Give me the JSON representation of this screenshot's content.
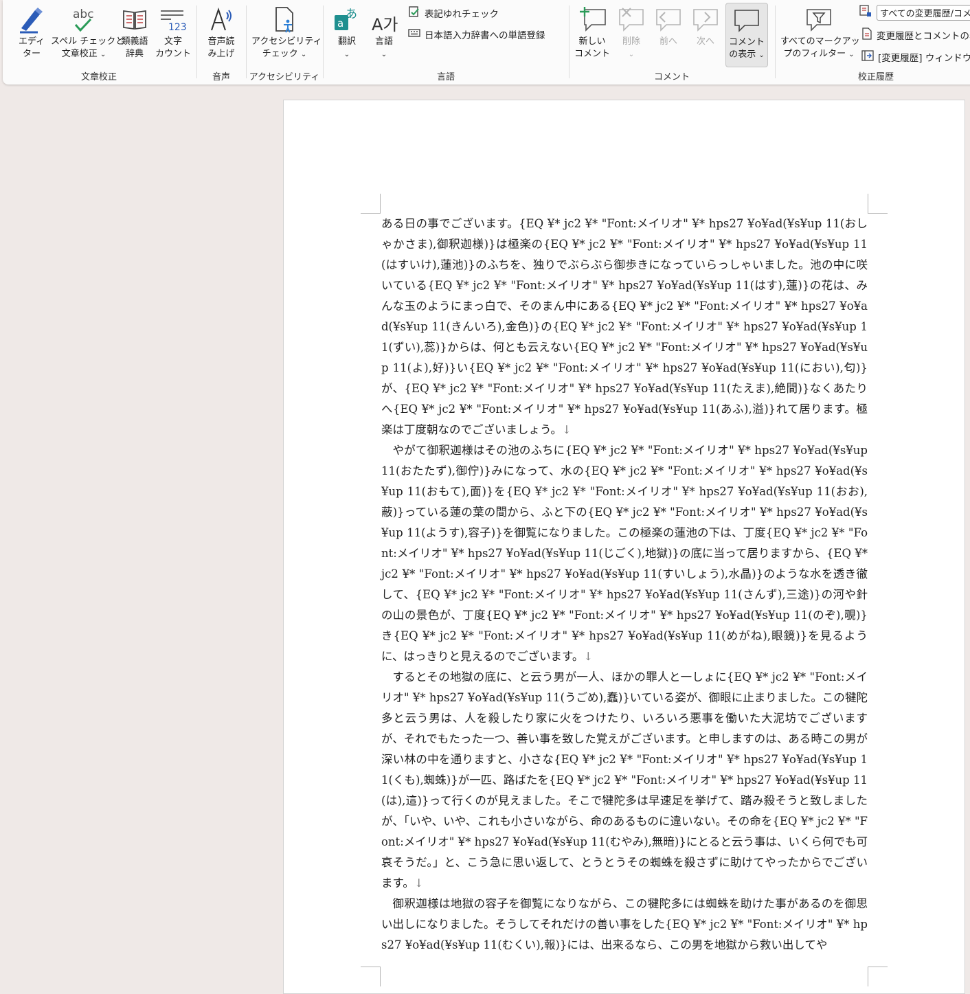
{
  "ribbon": {
    "groups": {
      "proofing": {
        "label": "文章校正",
        "editor": {
          "line1": "エディ",
          "line2": "ター"
        },
        "spelling": {
          "icon_text": "abc",
          "line1": "スペル チェックと",
          "line2": "文章校正"
        },
        "thesaurus": {
          "line1": "類義語",
          "line2": "辞典"
        },
        "wordcount": {
          "icon_text": "123",
          "line1": "文字",
          "line2": "カウント"
        }
      },
      "speech": {
        "label": "音声",
        "readaloud": {
          "line1": "音声読",
          "line2": "み上げ"
        }
      },
      "accessibility": {
        "label": "アクセシビリティ",
        "check": {
          "line1": "アクセシビリティ",
          "line2": "チェック"
        }
      },
      "language": {
        "label": "言語",
        "translate": {
          "label": "翻訳"
        },
        "language": {
          "icon_text": "A가",
          "label": "言語"
        },
        "consistency": "表記ゆれチェック",
        "dictionary": "日本語入力辞書への単語登録"
      },
      "comments": {
        "label": "コメント",
        "new": {
          "line1": "新しい",
          "line2": "コメント"
        },
        "delete": {
          "label": "削除"
        },
        "prev": {
          "label": "前へ"
        },
        "next": {
          "label": "次へ"
        },
        "show": {
          "line1": "コメント",
          "line2": "の表示"
        }
      },
      "tracking": {
        "label": "校正履歴",
        "filter": {
          "line1": "すべてのマークアッ",
          "line2": "プのフィルター"
        },
        "markup_combo": "すべての変更履歴/コメ",
        "show_markup": "変更履歴とコメントの表",
        "pane": "[変更履歴] ウィンドウ"
      }
    }
  },
  "document": {
    "paragraphs": [
      "ある日の事でございます。{EQ ¥* jc2 ¥* \"Font:メイリオ\" ¥* hps27 ¥o¥ad(¥s¥up 11(おしゃかさま),御釈迦様)}は極楽の{EQ ¥* jc2 ¥* \"Font:メイリオ\" ¥* hps27 ¥o¥ad(¥s¥up 11(はすいけ),蓮池)}のふちを、独りでぶらぶら御歩きになっていらっしゃいました。池の中に咲いている{EQ ¥* jc2 ¥* \"Font:メイリオ\" ¥* hps27 ¥o¥ad(¥s¥up 11(はす),蓮)}の花は、みんな玉のようにまっ白で、そのまん中にある{EQ ¥* jc2 ¥* \"Font:メイリオ\" ¥* hps27 ¥o¥ad(¥s¥up 11(きんいろ),金色)}の{EQ ¥* jc2 ¥* \"Font:メイリオ\" ¥* hps27 ¥o¥ad(¥s¥up 11(ずい),蕊)}からは、何とも云えない{EQ ¥* jc2 ¥* \"Font:メイリオ\" ¥* hps27 ¥o¥ad(¥s¥up 11(よ),好)}い{EQ ¥* jc2 ¥* \"Font:メイリオ\" ¥* hps27 ¥o¥ad(¥s¥up 11(におい),匂)}が、{EQ ¥* jc2 ¥* \"Font:メイリオ\" ¥* hps27 ¥o¥ad(¥s¥up 11(たえま),絶間)}なくあたりへ{EQ ¥* jc2 ¥* \"Font:メイリオ\" ¥* hps27 ¥o¥ad(¥s¥up 11(あふ),溢)}れて居ります。極楽は丁度朝なのでございましょう。",
      "やがて御釈迦様はその池のふちに{EQ ¥* jc2 ¥* \"Font:メイリオ\" ¥* hps27 ¥o¥ad(¥s¥up 11(おたたず),御佇)}みになって、水の{EQ ¥* jc2 ¥* \"Font:メイリオ\" ¥* hps27 ¥o¥ad(¥s¥up 11(おもて),面)}を{EQ ¥* jc2 ¥* \"Font:メイリオ\" ¥* hps27 ¥o¥ad(¥s¥up 11(おお),蔽)}っている蓮の葉の間から、ふと下の{EQ ¥* jc2 ¥* \"Font:メイリオ\" ¥* hps27 ¥o¥ad(¥s¥up 11(ようす),容子)}を御覧になりました。この極楽の蓮池の下は、丁度{EQ ¥* jc2 ¥* \"Font:メイリオ\" ¥* hps27 ¥o¥ad(¥s¥up 11(じごく),地獄)}の底に当って居りますから、{EQ ¥* jc2 ¥* \"Font:メイリオ\" ¥* hps27 ¥o¥ad(¥s¥up 11(すいしょう),水晶)}のような水を透き徹して、{EQ ¥* jc2 ¥* \"Font:メイリオ\" ¥* hps27 ¥o¥ad(¥s¥up 11(さんず),三途)}の河や針の山の景色が、丁度{EQ ¥* jc2 ¥* \"Font:メイリオ\" ¥* hps27 ¥o¥ad(¥s¥up 11(のぞ),覗)}き{EQ ¥* jc2 ¥* \"Font:メイリオ\" ¥* hps27 ¥o¥ad(¥s¥up 11(めがね),眼鏡)}を見るように、はっきりと見えるのでございます。",
      "するとその地獄の底に、と云う男が一人、ほかの罪人と一しょに{EQ ¥* jc2 ¥* \"Font:メイリオ\" ¥* hps27 ¥o¥ad(¥s¥up 11(うごめ),蠢)}いている姿が、御眼に止まりました。この犍陀多と云う男は、人を殺したり家に火をつけたり、いろいろ悪事を働いた大泥坊でございますが、それでもたった一つ、善い事を致した覚えがございます。と申しますのは、ある時この男が深い林の中を通りますと、小さな{EQ ¥* jc2 ¥* \"Font:メイリオ\" ¥* hps27 ¥o¥ad(¥s¥up 11(くも),蜘蛛)}が一匹、路ばたを{EQ ¥* jc2 ¥* \"Font:メイリオ\" ¥* hps27 ¥o¥ad(¥s¥up 11(は),這)}って行くのが見えました。そこで犍陀多は早速足を挙げて、踏み殺そうと致しましたが、「いや、いや、これも小さいながら、命のあるものに違いない。その命を{EQ ¥* jc2 ¥* \"Font:メイリオ\" ¥* hps27 ¥o¥ad(¥s¥up 11(むやみ),無暗)}にとると云う事は、いくら何でも可哀そうだ。」と、こう急に思い返して、とうとうその蜘蛛を殺さずに助けてやったからでございます。",
      "御釈迦様は地獄の容子を御覧になりながら、この犍陀多には蜘蛛を助けた事があるのを御思い出しになりました。そうしてそれだけの善い事をした{EQ ¥* jc2 ¥* \"Font:メイリオ\" ¥* hps27 ¥o¥ad(¥s¥up 11(むくい),報)}には、出来るなら、この男を地獄から救い出してや"
    ],
    "paragraph_mark": "↓"
  }
}
